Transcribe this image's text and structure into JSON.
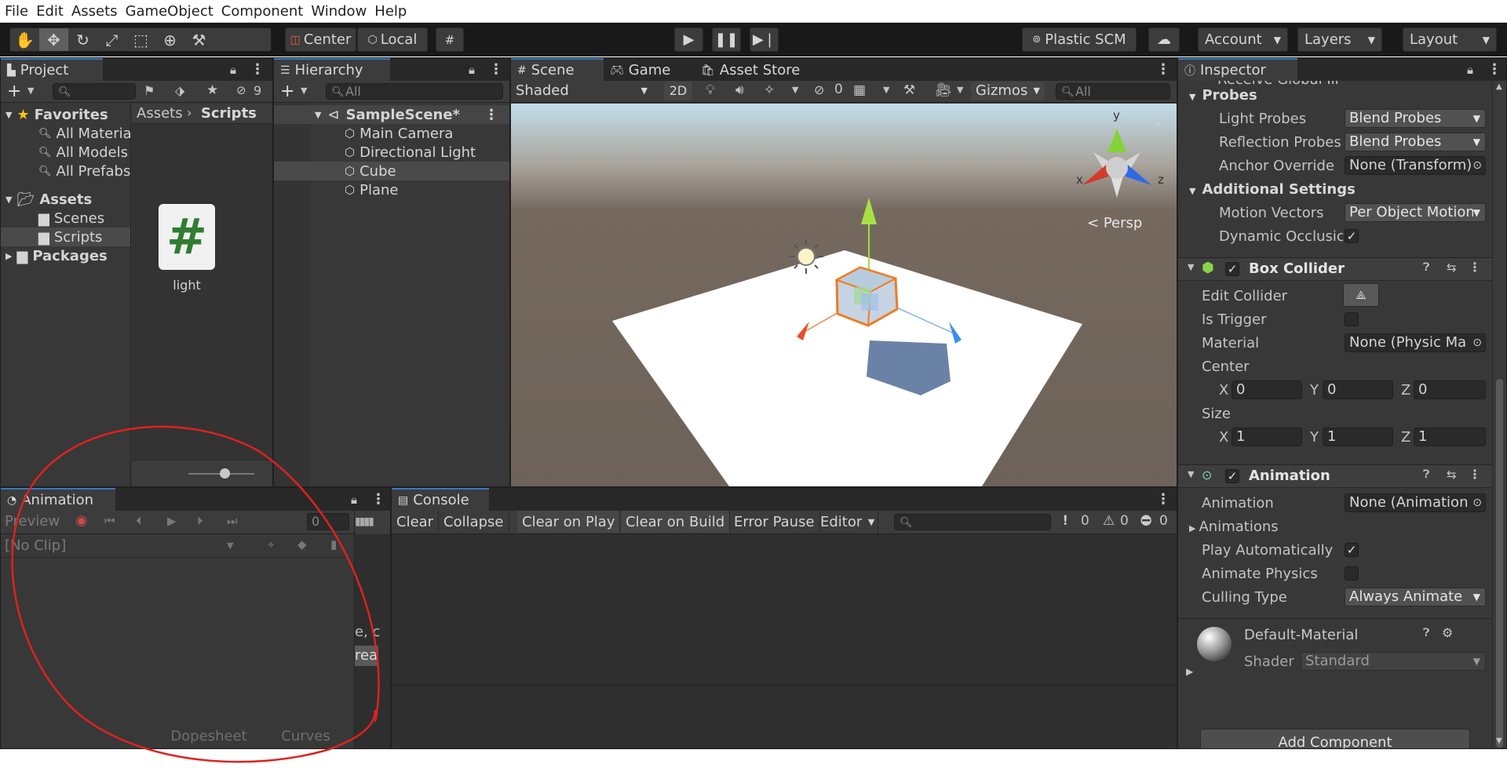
{
  "menu": [
    "File",
    "Edit",
    "Assets",
    "GameObject",
    "Component",
    "Window",
    "Help"
  ],
  "toolbar": {
    "pivot": "Center",
    "space": "Local",
    "plastic": "Plastic SCM",
    "account": "Account",
    "layers": "Layers",
    "layout": "Layout"
  },
  "project": {
    "tab": "Project",
    "hidden_count": "9",
    "favorites": "Favorites",
    "fav_items": [
      "All Materia",
      "All Models",
      "All Prefabs"
    ],
    "assets": "Assets",
    "asset_items": [
      "Scenes",
      "Scripts"
    ],
    "packages": "Packages",
    "breadcrumb_root": "Assets",
    "breadcrumb_current": "Scripts",
    "file_name": "light",
    "file_icon": "#"
  },
  "hierarchy": {
    "tab": "Hierarchy",
    "search_placeholder": "All",
    "scene": "SampleScene*",
    "items": [
      "Main Camera",
      "Directional Light",
      "Cube",
      "Plane"
    ]
  },
  "scene": {
    "tabs": [
      "Scene",
      "Game",
      "Asset Store"
    ],
    "shading": "Shaded",
    "mode2d": "2D",
    "hidden_count": "0",
    "gizmos": "Gizmos",
    "search_placeholder": "All",
    "persp": "Persp",
    "axis_x": "x",
    "axis_y": "y",
    "axis_z": "z"
  },
  "inspector": {
    "tab": "Inspector",
    "cut_text": "Receive Global Ill",
    "probes_header": "Probes",
    "light_probes": "Light Probes",
    "light_probes_val": "Blend Probes",
    "reflection_probes": "Reflection Probes",
    "reflection_probes_val": "Blend Probes",
    "anchor_override": "Anchor Override",
    "anchor_override_val": "None (Transform)",
    "additional_header": "Additional Settings",
    "motion_vectors": "Motion Vectors",
    "motion_vectors_val": "Per Object Motion",
    "dynamic_occlusion": "Dynamic Occlusic",
    "box_collider": "Box Collider",
    "edit_collider": "Edit Collider",
    "is_trigger": "Is Trigger",
    "material": "Material",
    "material_val": "None (Physic Ma",
    "center": "Center",
    "center_x": "0",
    "center_y": "0",
    "center_z": "0",
    "size": "Size",
    "size_x": "1",
    "size_y": "1",
    "size_z": "1",
    "animation_comp": "Animation",
    "animation": "Animation",
    "animation_val": "None (Animation",
    "animations": "Animations",
    "play_automatically": "Play Automatically",
    "animate_physics": "Animate Physics",
    "culling_type": "Culling Type",
    "culling_type_val": "Always Animate",
    "default_material": "Default-Material",
    "shader": "Shader",
    "shader_val": "Standard",
    "add_component": "Add Component",
    "x": "X",
    "y": "Y",
    "z": "Z"
  },
  "animation_panel": {
    "tab": "Animation",
    "preview": "Preview",
    "frame": "0",
    "clip": "[No Clip]",
    "dopesheet": "Dopesheet",
    "curves": "Curves",
    "cut1": "e, c",
    "cut2": "rea"
  },
  "console": {
    "tab": "Console",
    "buttons": [
      "Clear",
      "Collapse",
      "Clear on Play",
      "Clear on Build",
      "Error Pause",
      "Editor"
    ],
    "count_info": "0",
    "count_warn": "0",
    "count_err": "0"
  },
  "colors": {
    "accent": "#3a79bb",
    "annotation": "#e0211f"
  }
}
